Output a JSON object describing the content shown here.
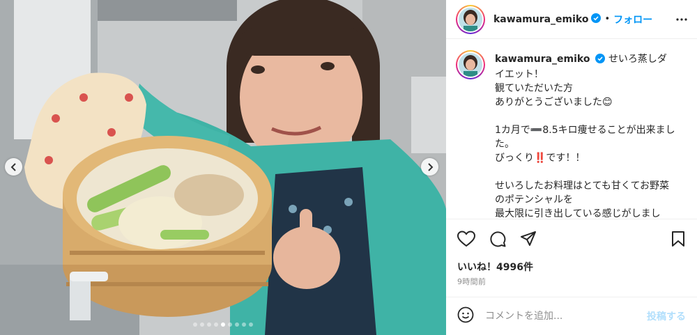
{
  "post": {
    "username": "kawamura_emiko",
    "follow_label": "フォロー",
    "separator": "•",
    "caption": "せいろ蒸しダイエット！\n観ていただいた方\nありがとうございました😊\n\n1カ月で➖8.5キロ痩せることが出来ました。\nびっくり‼️です！！\n\nせいろしたお料理はとても甘くてお野菜のポテンシャルを\n最大限に引き出している感じがしまし",
    "likes_text": "いいね！4996件",
    "time_ago": "9時間前",
    "comment_placeholder": "コメントを追加...",
    "post_label": "投稿する"
  },
  "carousel": {
    "total": 9,
    "active_index": 4
  },
  "colors": {
    "link": "#0095f6",
    "verified": "#0095f6",
    "muted": "#8e8e8e",
    "post_disabled": "#b2dffc"
  },
  "icons": [
    "heart-icon",
    "comment-icon",
    "share-icon",
    "bookmark-icon",
    "emoji-icon",
    "more-icon",
    "verified-icon",
    "chevron-left-icon",
    "chevron-right-icon"
  ]
}
